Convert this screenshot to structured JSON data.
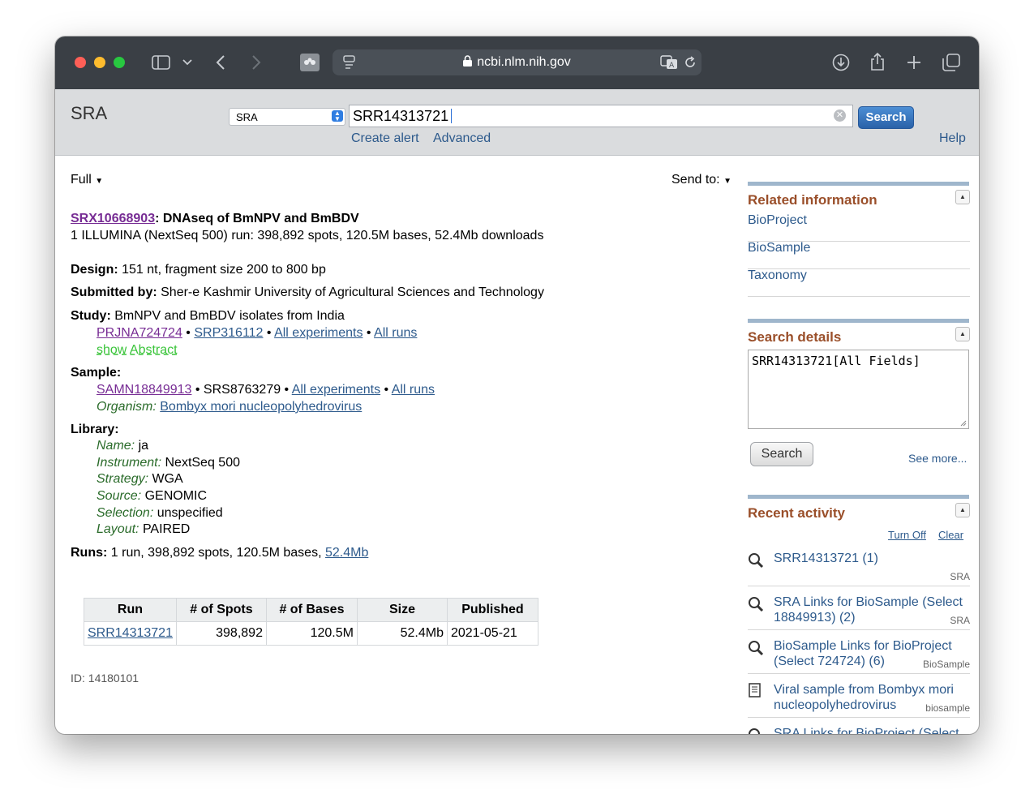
{
  "browser": {
    "url": "ncbi.nlm.nih.gov",
    "icons": [
      "sidebar-icon",
      "chevron-down-icon",
      "back-icon",
      "forward-icon",
      "extension-icon",
      "reader-icon",
      "lock-icon",
      "translate-icon",
      "reload-icon",
      "download-icon",
      "share-icon",
      "new-tab-icon",
      "tabs-icon"
    ]
  },
  "header": {
    "site_title": "SRA",
    "db_select": "SRA",
    "search_value": "SRR14313721",
    "search_button": "Search",
    "create_alert": "Create alert",
    "advanced": "Advanced",
    "help": "Help"
  },
  "toolbar": {
    "format": "Full",
    "send_to": "Send to:"
  },
  "record": {
    "accession": "SRX10668903",
    "title": ": DNAseq of BmNPV and BmBDV",
    "summary": "1 ILLUMINA (NextSeq 500) run: 398,892 spots, 120.5M bases, 52.4Mb downloads",
    "design_label": "Design:",
    "design": "151 nt, fragment size 200 to 800 bp",
    "submitted_label": "Submitted by:",
    "submitted": "Sher-e Kashmir University of Agricultural Sciences and Technology",
    "study_label": "Study:",
    "study": "BmNPV and BmBDV isolates from India",
    "study_links": {
      "prjna": "PRJNA724724",
      "srp": "SRP316112",
      "all_experiments": "All experiments",
      "all_runs": "All runs",
      "sep": "•"
    },
    "show_abstract": "show Abstract",
    "sample_label": "Sample:",
    "sample_links": {
      "samn": "SAMN18849913",
      "srs": "SRS8763279",
      "all_experiments": "All experiments",
      "all_runs": "All runs"
    },
    "organism_label": "Organism:",
    "organism": "Bombyx mori nucleopolyhedrovirus",
    "library_label": "Library:",
    "library": [
      {
        "k": "Name:",
        "v": "ja"
      },
      {
        "k": "Instrument:",
        "v": "NextSeq 500"
      },
      {
        "k": "Strategy:",
        "v": "WGA"
      },
      {
        "k": "Source:",
        "v": "GENOMIC"
      },
      {
        "k": "Selection:",
        "v": "unspecified"
      },
      {
        "k": "Layout:",
        "v": "PAIRED"
      }
    ],
    "runs_label": "Runs:",
    "runs_summary": "1 run, 398,892 spots, 120.5M bases,",
    "runs_size_link": "52.4Mb",
    "table": {
      "headers": [
        "Run",
        "# of Spots",
        "# of Bases",
        "Size",
        "Published"
      ],
      "row": [
        "SRR14313721",
        "398,892",
        "120.5M",
        "52.4Mb",
        "2021-05-21"
      ]
    },
    "id_line": "ID: 14180101"
  },
  "sidebar": {
    "related_title": "Related information",
    "related": [
      "BioProject",
      "BioSample",
      "Taxonomy"
    ],
    "details_title": "Search details",
    "details_query": "SRR14313721[All Fields]",
    "details_search": "Search",
    "see_more": "See more...",
    "recent_title": "Recent activity",
    "turn_off": "Turn Off",
    "clear": "Clear",
    "recent": [
      {
        "text": "SRR14313721 (1)",
        "db": "SRA",
        "icon": "search-icon"
      },
      {
        "text": "SRA Links for BioSample (Select 18849913) (2)",
        "db": "SRA",
        "icon": "search-icon"
      },
      {
        "text": "BioSample Links for BioProject (Select 724724) (6)",
        "db": "BioSample",
        "icon": "search-icon"
      },
      {
        "text": "Viral sample from Bombyx mori nucleopolyhedrovirus",
        "db": "biosample",
        "icon": "document-icon"
      },
      {
        "text": "SRA Links for BioProject (Select",
        "db": "",
        "icon": "search-icon"
      }
    ]
  },
  "colors": {
    "link": "#2d5a8c",
    "visited": "#772c94",
    "section_title": "#9a4f2a",
    "organism_label": "#2a6b2a"
  }
}
